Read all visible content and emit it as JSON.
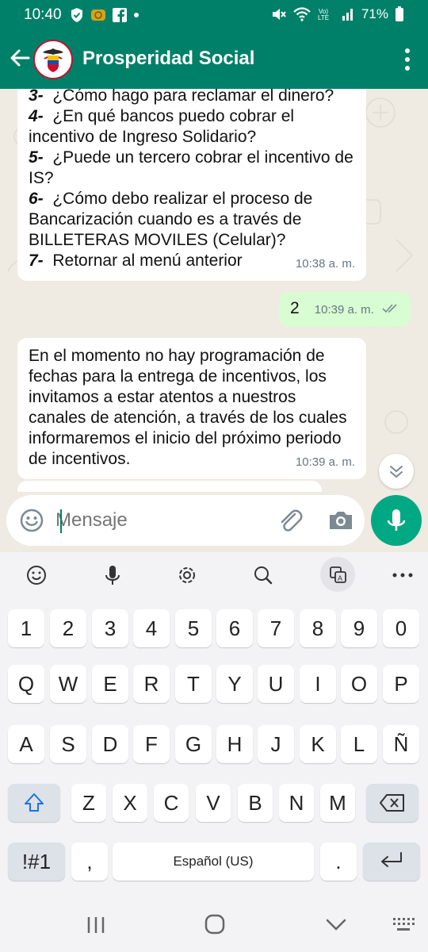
{
  "status_bar": {
    "time": "10:40",
    "battery": "71%",
    "icons": [
      "shield-icon",
      "coin-icon",
      "facebook-icon",
      "dot-icon",
      "mute-icon",
      "wifi-icon",
      "volte-icon",
      "signal-icon",
      "battery-icon"
    ]
  },
  "header": {
    "title": "Prosperidad Social"
  },
  "messages": [
    {
      "direction": "incoming",
      "items": [
        {
          "num": "3-",
          "text": "¿Cómo hago para reclamar el dinero?"
        },
        {
          "num": "4-",
          "text": "¿En qué bancos puedo cobrar el incentivo de Ingreso Solidario?"
        },
        {
          "num": "5-",
          "text": "¿Puede un tercero cobrar el incentivo de IS?"
        },
        {
          "num": "6-",
          "text": "¿Cómo debo realizar el proceso de Bancarización cuando es a través de BILLETERAS MOVILES (Celular)?"
        },
        {
          "num": "7-",
          "text": "Retornar al menú anterior"
        }
      ],
      "time": "10:38 a. m."
    },
    {
      "direction": "outgoing",
      "text": "2",
      "time": "10:39 a. m."
    },
    {
      "direction": "incoming",
      "text": "En el momento no hay programación de fechas para la entrega de incentivos, los invitamos a estar atentos a nuestros canales de atención, a través de los cuales informaremos el inicio del próximo periodo de incentivos.",
      "time": "10:39 a. m."
    }
  ],
  "composer": {
    "placeholder": "Mensaje"
  },
  "keyboard": {
    "toolbar": [
      "emoji-icon",
      "mic-icon",
      "settings-icon",
      "search-icon",
      "translate-icon",
      "more-icon"
    ],
    "row_numbers": [
      "1",
      "2",
      "3",
      "4",
      "5",
      "6",
      "7",
      "8",
      "9",
      "0"
    ],
    "row_1": [
      "Q",
      "W",
      "E",
      "R",
      "T",
      "Y",
      "U",
      "I",
      "O",
      "P"
    ],
    "row_2": [
      "A",
      "S",
      "D",
      "F",
      "G",
      "H",
      "J",
      "K",
      "L",
      "Ñ"
    ],
    "row_3": [
      "Z",
      "X",
      "C",
      "V",
      "B",
      "N",
      "M"
    ],
    "symbols_label": "!#1",
    "comma": ",",
    "space_label": "Español (US)",
    "period": "."
  }
}
